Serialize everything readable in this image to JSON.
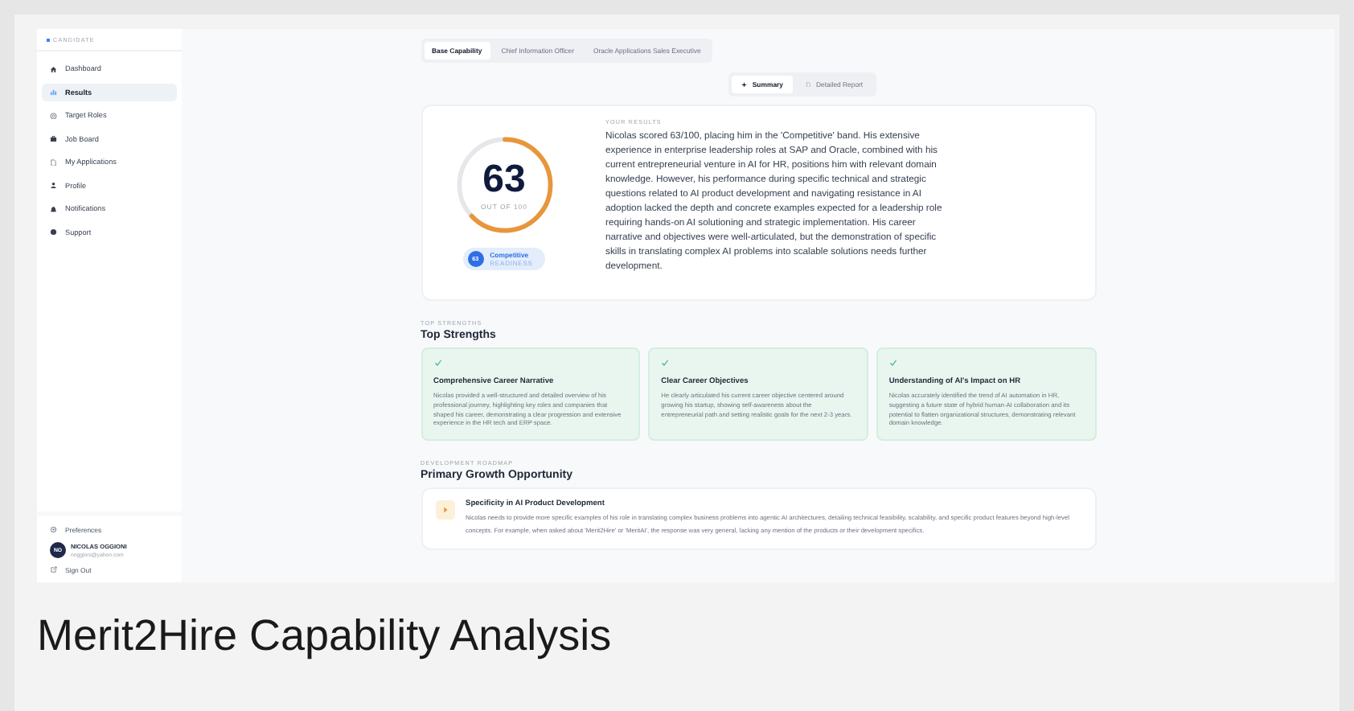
{
  "sidebar": {
    "section_label": "CANDIDATE",
    "items": [
      {
        "label": "Dashboard",
        "selected": false
      },
      {
        "label": "Results",
        "selected": true
      },
      {
        "label": "Target Roles",
        "selected": false
      },
      {
        "label": "Job Board",
        "selected": false
      },
      {
        "label": "My Applications",
        "selected": false
      },
      {
        "label": "Profile",
        "selected": false
      },
      {
        "label": "Notifications",
        "selected": false
      },
      {
        "label": "Support",
        "selected": false
      }
    ],
    "preferences": "Preferences",
    "user": {
      "initials": "NO",
      "name": "NICOLAS OGGIONI",
      "email": "noggioni@yahoo.com"
    },
    "sign_out": "Sign Out"
  },
  "tabs": [
    {
      "label": "Base Capability",
      "selected": true
    },
    {
      "label": "Chief Information Officer",
      "selected": false
    },
    {
      "label": "Oracle Applications Sales Executive",
      "selected": false
    }
  ],
  "view_toggle": [
    {
      "label": "Summary",
      "selected": true
    },
    {
      "label": "Detailed Report",
      "selected": false
    }
  ],
  "results": {
    "score": "63",
    "score_caption": "OUT OF 100",
    "band_badge": "63",
    "band": "Competitive",
    "band_caption": "READINESS",
    "section_label": "YOUR RESULTS",
    "text": "Nicolas scored 63/100, placing him in the 'Competitive' band. His extensive experience in enterprise leadership roles at SAP and Oracle, combined with his current entrepreneurial venture in AI for HR, positions him with relevant domain knowledge. However, his performance during specific technical and strategic questions related to AI product development and navigating resistance in AI adoption lacked the depth and concrete examples expected for a leadership role requiring hands-on AI solutioning and strategic implementation. His career narrative and objectives were well-articulated, but the demonstration of specific skills in translating complex AI problems into scalable solutions needs further development."
  },
  "strengths": {
    "eyebrow": "TOP STRENGTHS",
    "title": "Top Strengths",
    "cards": [
      {
        "title": "Comprehensive Career Narrative",
        "text": "Nicolas provided a well-structured and detailed overview of his professional journey, highlighting key roles and companies that shaped his career, demonstrating a clear progression and extensive experience in the HR tech and ERP space."
      },
      {
        "title": "Clear Career Objectives",
        "text": "He clearly articulated his current career objective centered around growing his startup, showing self-awareness about the entrepreneurial path and setting realistic goals for the next 2-3 years."
      },
      {
        "title": "Understanding of AI's Impact on HR",
        "text": "Nicolas accurately identified the trend of AI automation in HR, suggesting a future state of hybrid human-AI collaboration and its potential to flatten organizational structures, demonstrating relevant domain knowledge."
      }
    ]
  },
  "growth": {
    "eyebrow": "DEVELOPMENT ROADMAP",
    "title": "Primary Growth Opportunity",
    "items": [
      {
        "title": "Specificity in AI Product Development",
        "text": "Nicolas needs to provide more specific examples of his role in translating complex business problems into agentic AI architectures, detailing technical feasibility, scalability, and specific product features beyond high-level concepts. For example, when asked about 'Merit2Hire' or 'MeritAI', the response was very general, lacking any mention of the products or their development specifics."
      }
    ]
  },
  "caption": "Merit2Hire Capability Analysis"
}
